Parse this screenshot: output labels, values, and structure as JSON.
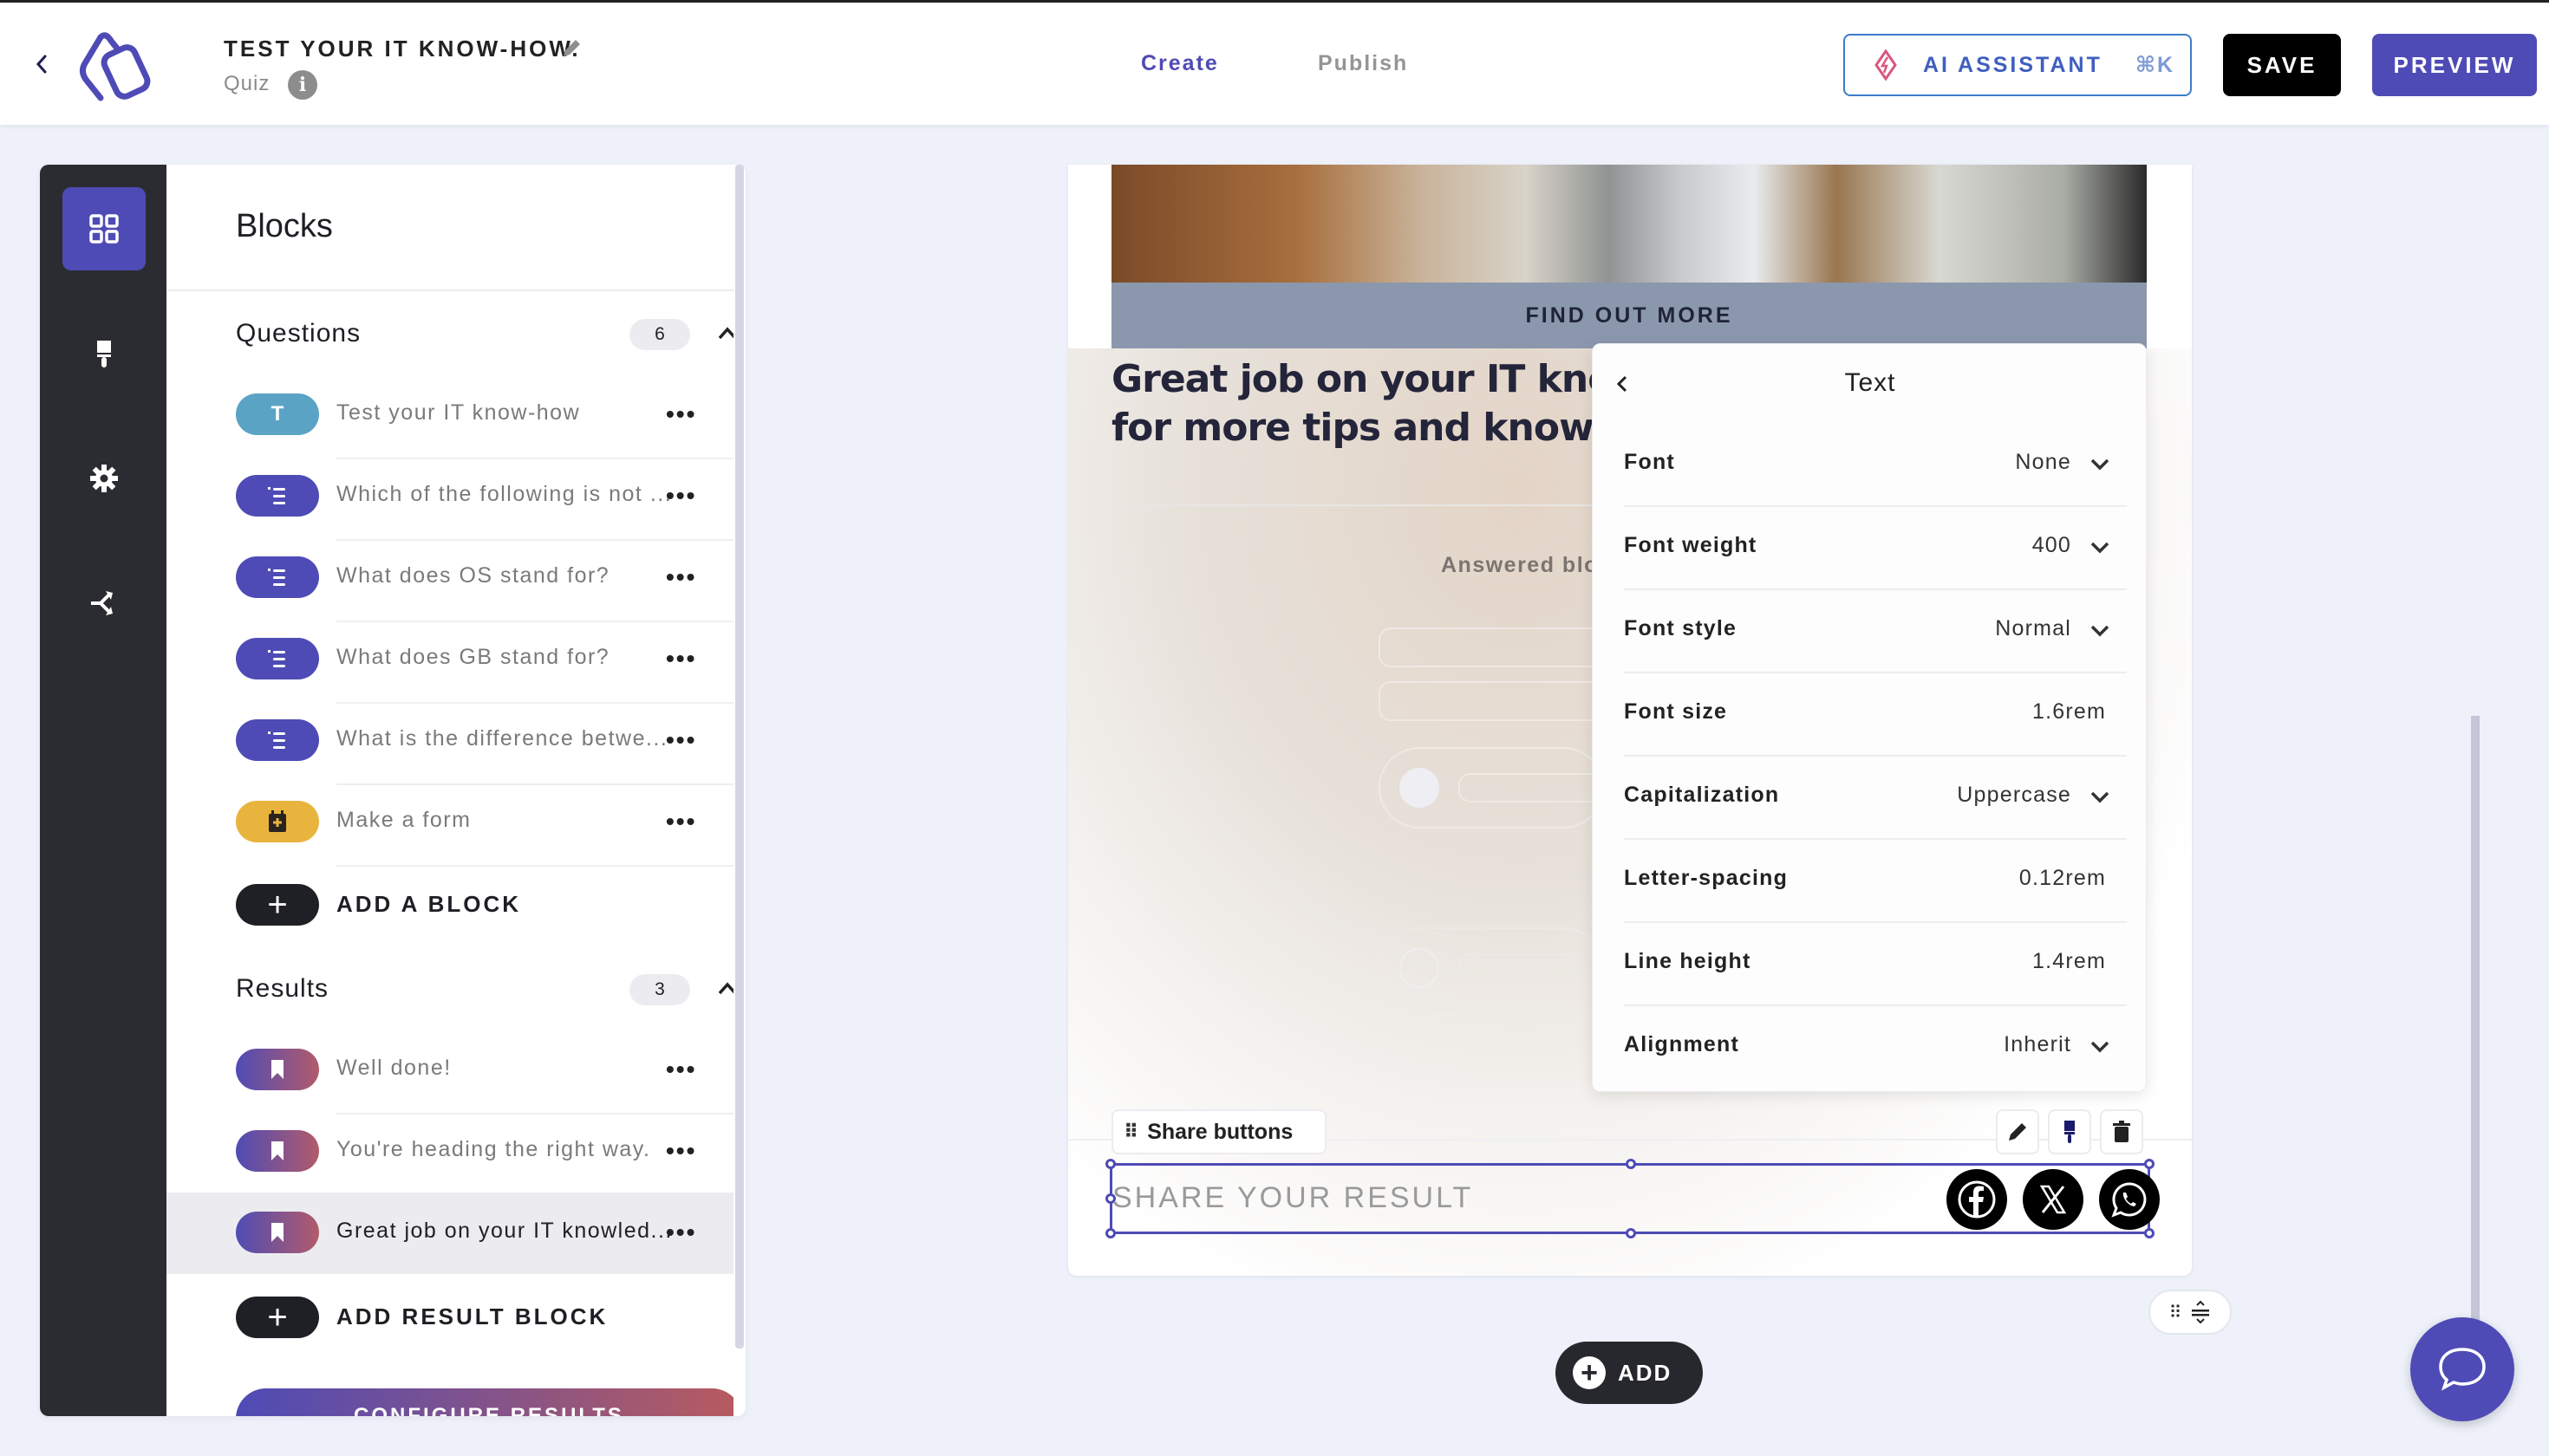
{
  "header": {
    "back_icon": "chevron-left-icon",
    "logo_icon": "app-logo-icon",
    "title": "TEST YOUR IT KNOW-HOW.",
    "edit_icon": "pencil-icon",
    "subtitle": "Quiz",
    "info_icon": "info-icon",
    "info_glyph": "i",
    "tabs": [
      {
        "label": "Create",
        "active": true
      },
      {
        "label": "Publish",
        "active": false
      }
    ],
    "ai_assistant": {
      "label": "AI ASSISTANT",
      "shortcut": "⌘K",
      "icon": "sparkle-icon"
    },
    "save_label": "SAVE",
    "preview_label": "PREVIEW",
    "colors": {
      "accent": "#4e4bb6",
      "ai_border": "#3d7cc9"
    }
  },
  "sidebar": {
    "rail": [
      {
        "name": "blocks",
        "icon": "grid-icon",
        "active": true
      },
      {
        "name": "design",
        "icon": "paintbrush-icon",
        "active": false
      },
      {
        "name": "settings",
        "icon": "gear-icon",
        "active": false
      },
      {
        "name": "logic",
        "icon": "branch-icon",
        "active": false
      }
    ],
    "panel_title": "Blocks",
    "questions": {
      "heading": "Questions",
      "count": "6",
      "items": [
        {
          "type": "text",
          "badge": "T",
          "label": "Test your IT know-how"
        },
        {
          "type": "list",
          "badge": "",
          "label": "Which of the following is not ..."
        },
        {
          "type": "list",
          "badge": "",
          "label": "What does OS stand for?"
        },
        {
          "type": "list",
          "badge": "",
          "label": "What does GB stand for?"
        },
        {
          "type": "list",
          "badge": "",
          "label": "What is the difference betwe..."
        },
        {
          "type": "form",
          "badge": "",
          "label": "Make a form"
        }
      ],
      "add_label": "ADD A BLOCK"
    },
    "results": {
      "heading": "Results",
      "count": "3",
      "items": [
        {
          "label": "Well done!",
          "selected": false
        },
        {
          "label": "You're heading the right way.",
          "selected": false
        },
        {
          "label": "Great job on your IT knowled...",
          "selected": true
        }
      ],
      "add_label": "ADD RESULT BLOCK"
    },
    "more_glyph": "•••",
    "plus_glyph": "+",
    "configure_label": "CONFIGURE RESULTS"
  },
  "canvas": {
    "find_out_more": "FIND OUT MORE",
    "result_heading_line1": "Great job on your IT know",
    "result_heading_line2": "for more tips and know-h",
    "answered_label": "Answered blo",
    "share_block_tag": "Share buttons",
    "share_text": "SHARE YOUR RESULT",
    "social": [
      {
        "name": "facebook",
        "icon": "facebook-icon"
      },
      {
        "name": "x",
        "icon": "x-twitter-icon"
      },
      {
        "name": "whatsapp",
        "icon": "whatsapp-icon"
      }
    ],
    "tools": [
      {
        "name": "edit",
        "icon": "pencil-icon"
      },
      {
        "name": "style",
        "icon": "paintbrush-icon"
      },
      {
        "name": "delete",
        "icon": "trash-icon"
      }
    ],
    "selection_color": "#4e4bb6"
  },
  "text_panel": {
    "title": "Text",
    "rows": [
      {
        "label": "Font",
        "value": "None",
        "dropdown": true
      },
      {
        "label": "Font weight",
        "value": "400",
        "dropdown": true
      },
      {
        "label": "Font style",
        "value": "Normal",
        "dropdown": true
      },
      {
        "label": "Font size",
        "value": "1.6rem",
        "dropdown": false
      },
      {
        "label": "Capitalization",
        "value": "Uppercase",
        "dropdown": true
      },
      {
        "label": "Letter-spacing",
        "value": "0.12rem",
        "dropdown": false
      },
      {
        "label": "Line height",
        "value": "1.4rem",
        "dropdown": false
      },
      {
        "label": "Alignment",
        "value": "Inherit",
        "dropdown": true
      }
    ]
  },
  "footer": {
    "add_label": "ADD",
    "add_glyph": "+",
    "chat_icon": "chat-bubble-icon",
    "reorder_icon": "drag-reorder-icon"
  }
}
